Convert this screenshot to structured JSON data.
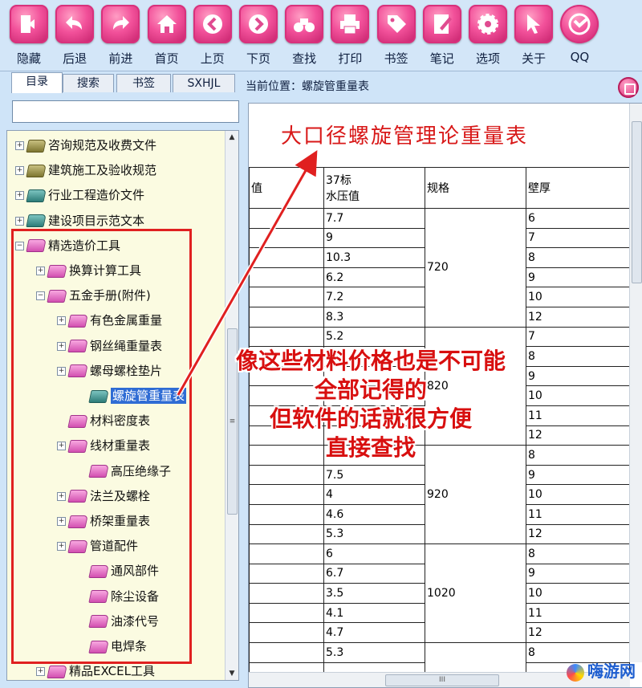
{
  "toolbar": {
    "buttons": [
      {
        "label": "隐藏",
        "icon": "hide-icon"
      },
      {
        "label": "后退",
        "icon": "back-icon"
      },
      {
        "label": "前进",
        "icon": "forward-icon"
      },
      {
        "label": "首页",
        "icon": "home-icon"
      },
      {
        "label": "上页",
        "icon": "prev-page-icon"
      },
      {
        "label": "下页",
        "icon": "next-page-icon"
      },
      {
        "label": "查找",
        "icon": "binoculars-icon"
      },
      {
        "label": "打印",
        "icon": "printer-icon"
      },
      {
        "label": "书签",
        "icon": "tag-icon"
      },
      {
        "label": "笔记",
        "icon": "note-icon"
      },
      {
        "label": "选项",
        "icon": "gear-icon"
      },
      {
        "label": "关于",
        "icon": "pointer-icon"
      },
      {
        "label": "QQ",
        "icon": "qq-icon"
      }
    ]
  },
  "sidebar": {
    "tabs": [
      "目录",
      "搜索",
      "书签",
      "SXHJL"
    ],
    "search_value": "",
    "tree": [
      {
        "label": "咨询规范及收费文件",
        "exp": "+",
        "book": "olive"
      },
      {
        "label": "建筑施工及验收规范",
        "exp": "+",
        "book": "olive"
      },
      {
        "label": "行业工程造价文件",
        "exp": "+",
        "book": "teal"
      },
      {
        "label": "建设项目示范文本",
        "exp": "+",
        "book": "teal"
      },
      {
        "label": "精选造价工具",
        "exp": "−",
        "book": "pink"
      },
      {
        "label": "换算计算工具",
        "exp": "+",
        "book": "pink"
      },
      {
        "label": "五金手册(附件)",
        "exp": "−",
        "book": "pink"
      },
      {
        "label": "有色金属重量",
        "exp": "+",
        "book": "pink"
      },
      {
        "label": "钢丝绳重量表",
        "exp": "+",
        "book": "pink"
      },
      {
        "label": "螺母螺栓垫片",
        "exp": "+",
        "book": "pink"
      },
      {
        "label": "螺旋管重量表",
        "exp": "",
        "book": "teal"
      },
      {
        "label": "材料密度表",
        "exp": "",
        "book": "pink"
      },
      {
        "label": "线材重量表",
        "exp": "+",
        "book": "pink"
      },
      {
        "label": "高压绝缘子",
        "exp": "",
        "book": "pink"
      },
      {
        "label": "法兰及螺栓",
        "exp": "+",
        "book": "pink"
      },
      {
        "label": "桥架重量表",
        "exp": "+",
        "book": "pink"
      },
      {
        "label": "管道配件",
        "exp": "+",
        "book": "pink"
      },
      {
        "label": "通风部件",
        "exp": "",
        "book": "pink"
      },
      {
        "label": "除尘设备",
        "exp": "",
        "book": "pink"
      },
      {
        "label": "油漆代号",
        "exp": "",
        "book": "pink"
      },
      {
        "label": "电焊条",
        "exp": "",
        "book": "pink"
      },
      {
        "label": "精品EXCEL工具",
        "exp": "+",
        "book": "pink"
      }
    ]
  },
  "location": {
    "label": "当前位置：",
    "value": "螺旋管重量表"
  },
  "document": {
    "title": "大口径螺旋管理论重量表",
    "headers": [
      "值",
      "37标\n水压值",
      "规格",
      "壁厚"
    ],
    "rows": [
      {
        "c2": "7.7",
        "c4": "6"
      },
      {
        "c2": "9",
        "c4": "7"
      },
      {
        "c2": "10.3",
        "c4": "8"
      },
      {
        "c2": "6.2",
        "c4": "9"
      },
      {
        "c2": "7.2",
        "c4": "10"
      },
      {
        "c2": "8.3",
        "c4": "12"
      },
      {
        "c2": "5.2",
        "c4": "7"
      },
      {
        "c2": "",
        "c4": "8"
      },
      {
        "c2": "",
        "c4": "9"
      },
      {
        "c2": "",
        "c4": "10"
      },
      {
        "c2": "",
        "c4": "11"
      },
      {
        "c2": "",
        "c4": "12"
      },
      {
        "c2": "",
        "c4": "8"
      },
      {
        "c2": "7.5",
        "c4": "9"
      },
      {
        "c2": "4",
        "c4": "10"
      },
      {
        "c2": "4.6",
        "c4": "11"
      },
      {
        "c2": "5.3",
        "c4": "12"
      },
      {
        "c2": "6",
        "c4": "8"
      },
      {
        "c2": "6.7",
        "c4": "9"
      },
      {
        "c2": "3.5",
        "c4": "10"
      },
      {
        "c2": "4.1",
        "c4": "11"
      },
      {
        "c2": "4.7",
        "c4": "12"
      },
      {
        "c2": "5.3",
        "c4": "8"
      },
      {
        "c2": "",
        "c4": ""
      }
    ],
    "spec_groups": [
      "720",
      "820",
      "920",
      "1020",
      ""
    ]
  },
  "annotation": {
    "lines": [
      "像这些材料价格也是不可能",
      "全部记得的",
      "但软件的话就很方便",
      "直接查找"
    ],
    "color": "#d80f0f"
  },
  "watermark": {
    "text": "嗨游网"
  }
}
